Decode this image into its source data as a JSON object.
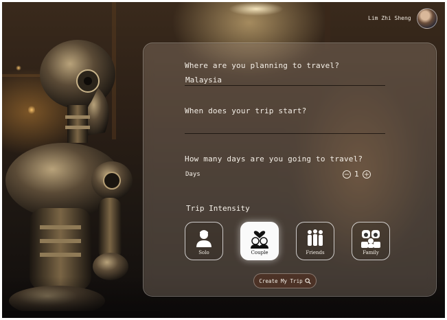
{
  "header": {
    "user_name": "Lim Zhi Sheng"
  },
  "form": {
    "destination": {
      "question": "Where are you planning to travel?",
      "value": "Malaysia"
    },
    "start_date": {
      "question": "When does your trip start?",
      "value": ""
    },
    "duration": {
      "question": "How many days are you going to travel?",
      "label": "Days",
      "value": "1",
      "minus": "−",
      "plus": "+"
    },
    "intensity": {
      "title": "Trip Intensity",
      "options": [
        {
          "label": "Solo",
          "icon": "person-icon",
          "selected": false
        },
        {
          "label": "Couple",
          "icon": "couple-heart-icon",
          "selected": true
        },
        {
          "label": "Friends",
          "icon": "group-icon",
          "selected": false
        },
        {
          "label": "Family",
          "icon": "family-icon",
          "selected": false
        }
      ]
    },
    "submit_label": "Create My Trip"
  }
}
